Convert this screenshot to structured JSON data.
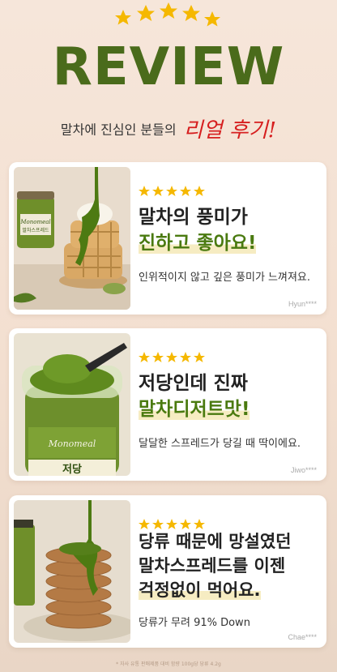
{
  "header": {
    "title": "REVIEW",
    "subtitle": "말차에 진심인 분들의",
    "subtitle_highlight": "리얼 후기!"
  },
  "colors": {
    "brand_green": "#4a6b1b",
    "star_gold": "#f5b800",
    "accent_red": "#d61f1f",
    "highlight": "#f6ecc2"
  },
  "reviews": [
    {
      "rating": 5,
      "headline_line1": "말차의 풍미가",
      "headline_line2": "진하고 좋아요!",
      "description": "인위적이지 않고 깊은 풍미가 느껴져요.",
      "author": "Hyun****"
    },
    {
      "rating": 5,
      "headline_line1": "저당인데 진짜",
      "headline_line2": "말차디저트맛!",
      "description": "달달한 스프레드가 당길 때 딱이에요.",
      "author": "Jiwo****"
    },
    {
      "rating": 5,
      "headline_line1": "당류 때문에 망설였던",
      "headline_line2": "말차스프레드를 이젠",
      "headline_line3": "걱정없이 먹어요.",
      "description": "당류가 무려 91% Down",
      "author": "Chae****"
    }
  ],
  "product": {
    "brand": "Monomeal",
    "label": "저당",
    "label_sub": "말차스프레드"
  },
  "footnote": "* 자사 유통 판매제품 대비 함량 100g당 당류 4.2g"
}
